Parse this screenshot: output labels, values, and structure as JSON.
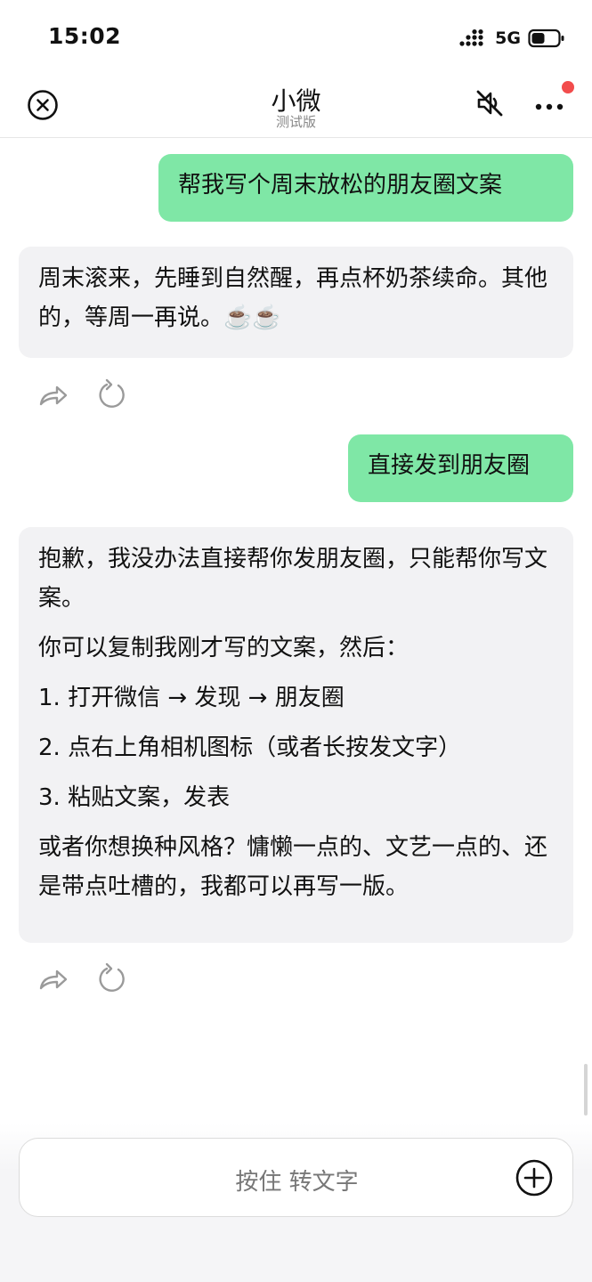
{
  "status_bar": {
    "time": "15:02",
    "network": "5G"
  },
  "header": {
    "title": "小微",
    "subtitle": "测试版"
  },
  "icons": {
    "close": "close-circle-icon",
    "mute": "mute-icon",
    "more": "more-icon",
    "share": "share-icon",
    "regenerate": "refresh-icon",
    "add": "add-circle-icon"
  },
  "colors": {
    "user_bubble": "#7fe7a6",
    "bot_bubble": "#f2f2f4",
    "badge": "#f24c4c"
  },
  "messages": [
    {
      "role": "user",
      "text": "帮我写个周末放松的朋友圈文案"
    },
    {
      "role": "assistant",
      "text": "周末滚来，先睡到自然醒，再点杯奶茶续命。其他的，等周一再说。☕️☕️"
    },
    {
      "role": "user",
      "text": "直接发到朋友圈"
    },
    {
      "role": "assistant",
      "paragraphs": [
        "抱歉，我没办法直接帮你发朋友圈，只能帮你写文案。",
        "你可以复制我刚才写的文案，然后：",
        "1. 打开微信 → 发现 → 朋友圈",
        "2. 点右上角相机图标（或者长按发文字）",
        "3. 粘贴文案，发表",
        "或者你想换种风格？慵懒一点的、文艺一点的、还是带点吐槽的，我都可以再写一版。"
      ]
    }
  ],
  "input": {
    "label": "按住 转文字"
  }
}
